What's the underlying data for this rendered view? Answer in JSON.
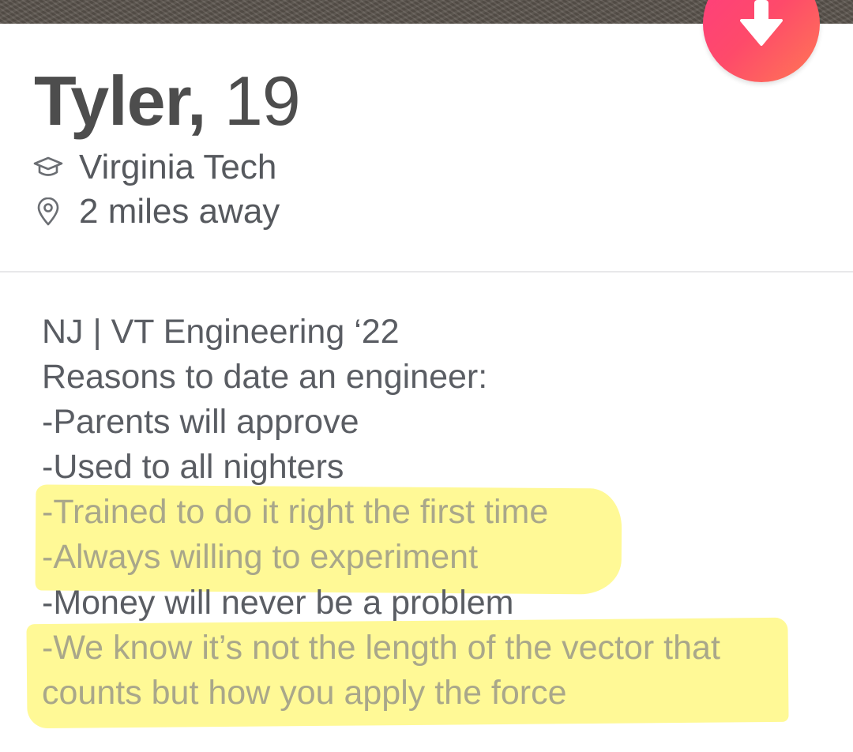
{
  "profile": {
    "name": "Tyler,",
    "age": "19",
    "school": "Virginia Tech",
    "distance": "2 miles away"
  },
  "icons": {
    "school": "graduation-cap-icon",
    "distance": "location-pin-icon",
    "collapse": "arrow-down-icon"
  },
  "colors": {
    "accent_gradient_start": "#ff3d7f",
    "accent_gradient_end": "#ff7854",
    "highlight": "#fff778"
  },
  "bio": {
    "lines": [
      "NJ | VT Engineering ‘22",
      "Reasons to date an engineer:",
      "-Parents will approve",
      "-Used to all nighters",
      "-Trained to do it right the first time",
      "-Always willing to experiment",
      "-Money will never be a problem",
      "-We know it’s not the length of the vector that",
      "counts but how you apply the force"
    ]
  }
}
